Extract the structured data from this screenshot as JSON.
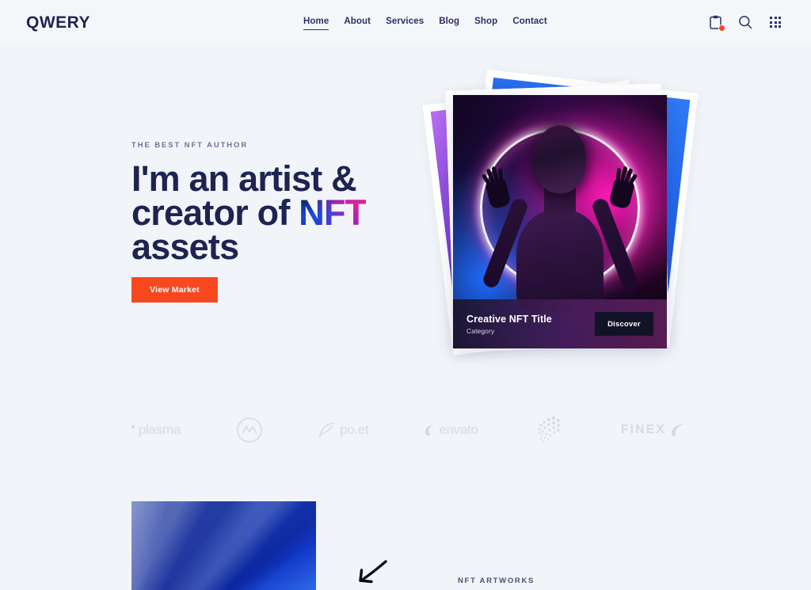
{
  "colors": {
    "page_bg": "#f1f5f9",
    "ink": "#1e2451",
    "accent_orange": "#f8481f",
    "muted": "#6c7496",
    "logo_brand": "#1e2451",
    "card_dark": "#121327"
  },
  "header": {
    "logo": "QWERY",
    "nav": [
      {
        "label": "Home",
        "active": true
      },
      {
        "label": "About",
        "active": false
      },
      {
        "label": "Services",
        "active": false
      },
      {
        "label": "Blog",
        "active": false
      },
      {
        "label": "Shop",
        "active": false
      },
      {
        "label": "Contact",
        "active": false
      }
    ],
    "icons": [
      {
        "name": "clipboard-icon",
        "badge": true
      },
      {
        "name": "search-icon",
        "badge": false
      },
      {
        "name": "grid-menu-icon",
        "badge": false
      }
    ]
  },
  "hero": {
    "eyebrow": "THE BEST NFT AUTHOR",
    "title_line1": "I'm an artist &",
    "title_line2_pre": "creator of ",
    "title_line2_accent": "NFT",
    "title_line3": "assets",
    "cta_label": "View Market"
  },
  "showcase_card": {
    "title": "Creative NFT Title",
    "category": "Category",
    "button_label": "Discover"
  },
  "brands": [
    {
      "name": "plasma",
      "label": "plasma"
    },
    {
      "name": "coinmarketcap",
      "label": ""
    },
    {
      "name": "poet",
      "label": "po.et"
    },
    {
      "name": "envato",
      "label": "envato"
    },
    {
      "name": "iota",
      "label": ""
    },
    {
      "name": "finex",
      "label": "FINEX"
    }
  ],
  "bottom": {
    "section_label": "NFT ARTWORKS"
  }
}
